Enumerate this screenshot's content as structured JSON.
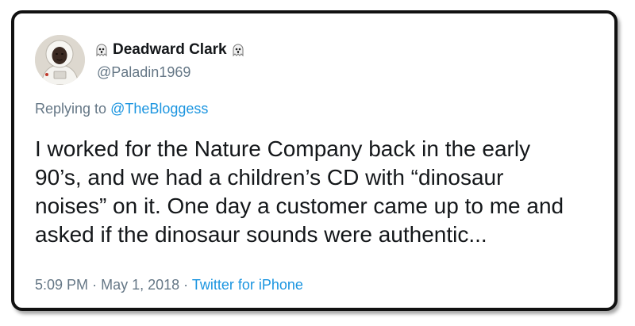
{
  "tweet": {
    "display_name": "Deadward Clark",
    "name_emoji_left": "ghost-emoji",
    "name_emoji_right": "ghost-emoji",
    "handle": "@Paladin1969",
    "replying_prefix": "Replying to",
    "replying_mention": "@TheBloggess",
    "text_lines": [
      "I worked for the Nature Company back in the early",
      "90’s, and we had a children’s CD with “dinosaur",
      "noises” on it. One day a customer came up to me and",
      "asked if the dinosaur sounds were authentic..."
    ],
    "time": "5:09 PM",
    "separator": "·",
    "date": "May 1, 2018",
    "source": "Twitter for iPhone"
  },
  "colors": {
    "text": "#14171a",
    "secondary": "#657786",
    "link": "#1b95e0",
    "border": "#111111"
  }
}
